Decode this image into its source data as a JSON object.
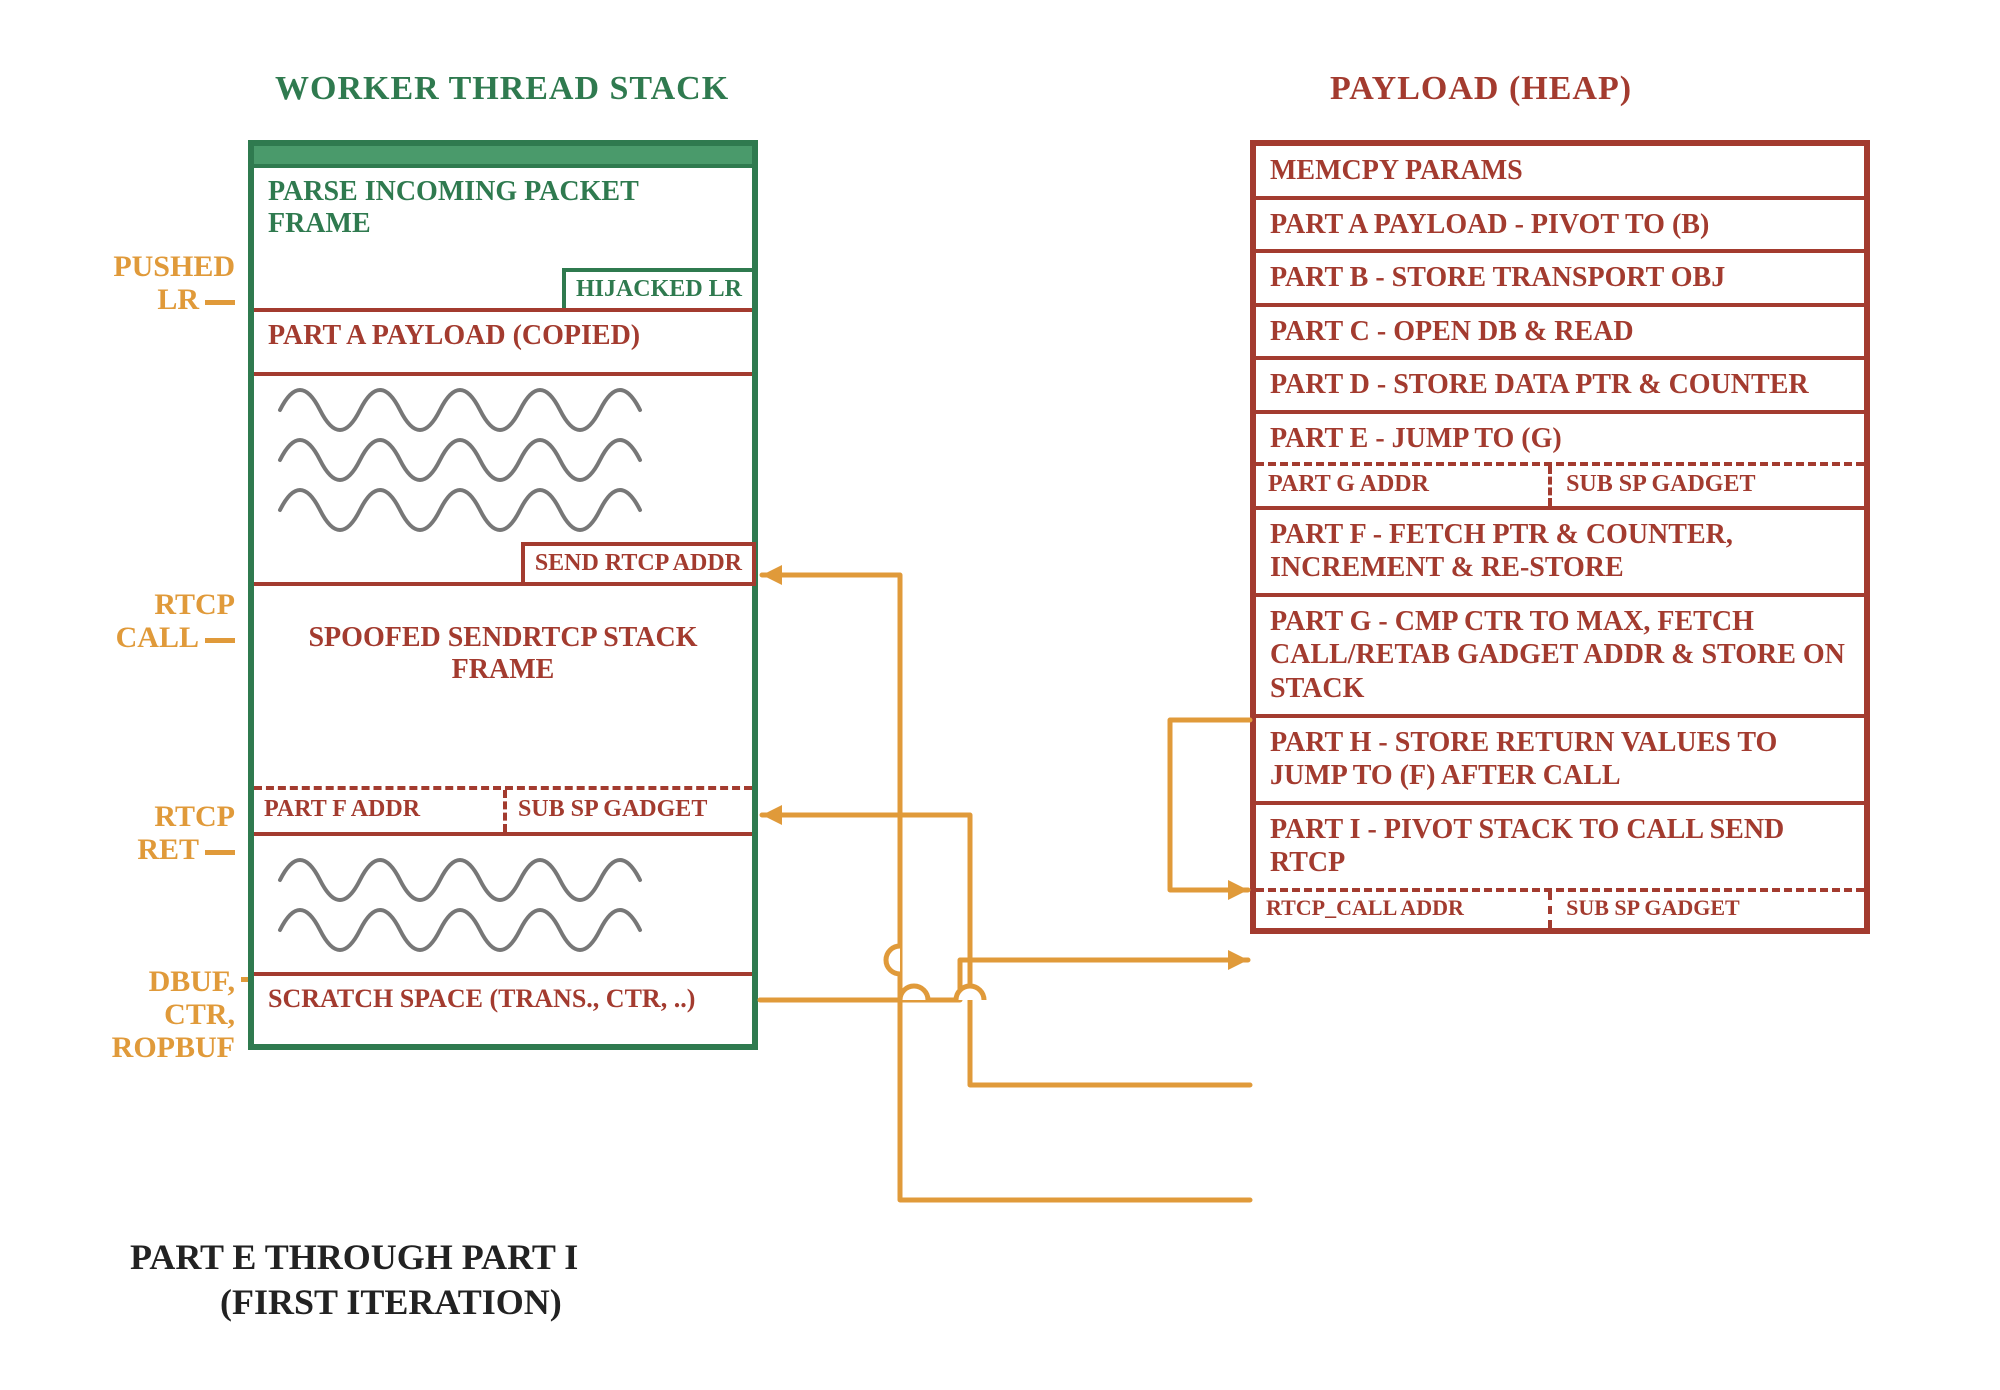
{
  "titles": {
    "left": "WORKER THREAD STACK",
    "right": "PAYLOAD (HEAP)"
  },
  "stack": {
    "parse_label": "PARSE INCOMING PACKET FRAME",
    "hijacked_lr": "HIJACKED LR",
    "part_a_copied": "PART A PAYLOAD (COPIED)",
    "send_rtcp_addr": "SEND RTCP ADDR",
    "spoofed_frame": "SPOOFED SENDRTCP STACK FRAME",
    "part_f_addr": "PART F ADDR",
    "sub_sp_gadget": "SUB SP GADGET",
    "scratch": "SCRATCH SPACE (TRANS., CTR, ..)"
  },
  "side_labels": {
    "pushed_lr": "PUSHED LR",
    "rtcp_call": "RTCP CALL",
    "rtcp_ret": "RTCP RET",
    "dbuf": "DBUF, CTR, ROPBUF"
  },
  "heap": {
    "r0": "MEMCPY PARAMS",
    "r1": "PART A PAYLOAD - PIVOT TO (B)",
    "r2": "PART B - STORE TRANSPORT OBJ",
    "r3": "PART C - OPEN DB & READ",
    "r4": "PART D - STORE DATA PTR & COUNTER",
    "r5": "PART E - JUMP TO (G)",
    "r5a": "PART G ADDR",
    "r5b": "SUB SP GADGET",
    "r6": "PART F - FETCH PTR & COUNTER, INCREMENT & RE-STORE",
    "r7": "PART G - CMP CTR TO MAX, FETCH CALL/RETAB GADGET ADDR & STORE ON STACK",
    "r8": "PART H - STORE RETURN VALUES TO JUMP TO (F) AFTER CALL",
    "r9": "PART I - PIVOT STACK TO CALL SEND RTCP",
    "r9a": "RTCP_CALL ADDR",
    "r9b": "SUB SP GADGET"
  },
  "caption": {
    "line1": "PART E THROUGH PART I",
    "line2": "(FIRST ITERATION)"
  }
}
